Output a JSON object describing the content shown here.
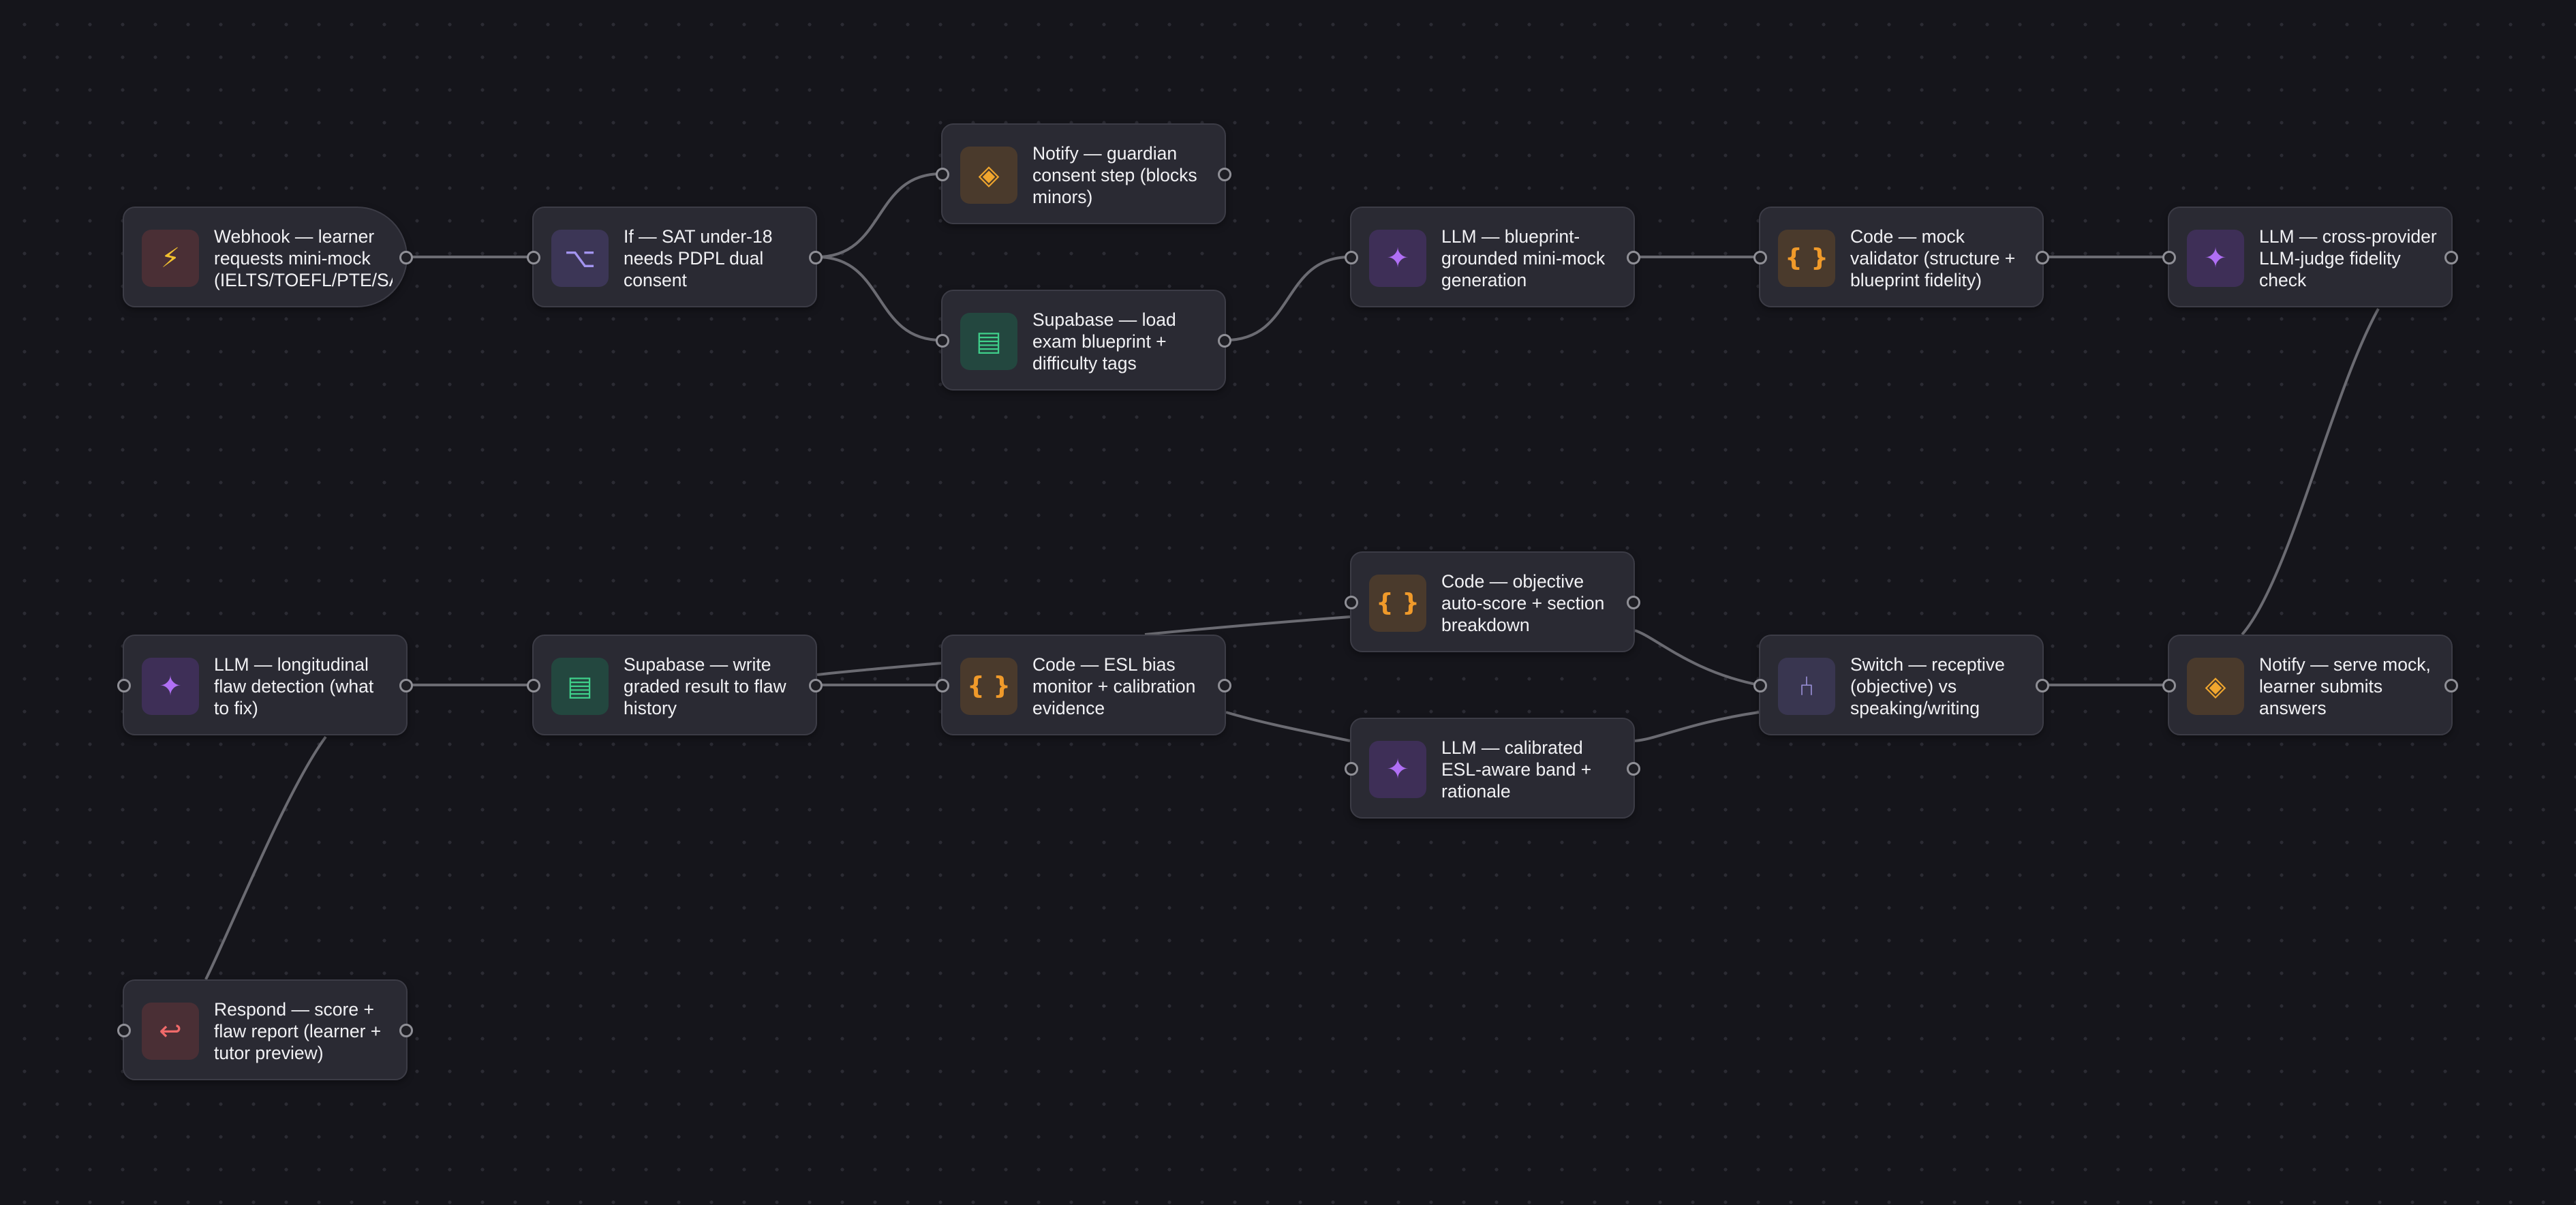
{
  "workflow": {
    "nodes": {
      "webhook": {
        "label": "Webhook — learner requests mini-mock (IELTS/TOEFL/PTE/SAT)",
        "icon": "lightning-icon",
        "symbol": "⚡"
      },
      "if_sat": {
        "label": "If — SAT under-18 needs PDPL dual consent",
        "icon": "branch-icon",
        "symbol": "⌥"
      },
      "notify_guardian": {
        "label": "Notify — guardian consent step (blocks minors)",
        "icon": "diamond-icon",
        "symbol": "◈"
      },
      "supabase_load": {
        "label": "Supabase — load exam blueprint + difficulty tags",
        "icon": "database-table-icon",
        "symbol": "▤"
      },
      "llm_generate": {
        "label": "LLM — blueprint-grounded mini-mock generation",
        "icon": "sparkle-icon",
        "symbol": "✦"
      },
      "code_validator": {
        "label": "Code — mock validator (structure + blueprint fidelity)",
        "icon": "code-braces-icon",
        "symbol": "{ }"
      },
      "llm_judge": {
        "label": "LLM — cross-provider LLM-judge fidelity check",
        "icon": "sparkle-icon",
        "symbol": "✦"
      },
      "notify_serve": {
        "label": "Notify — serve mock, learner submits answers",
        "icon": "diamond-icon",
        "symbol": "◈"
      },
      "switch_receptive": {
        "label": "Switch — receptive (objective) vs speaking/writing",
        "icon": "split-icon",
        "symbol": "⑃"
      },
      "code_autoscore": {
        "label": "Code — objective auto-score + section breakdown",
        "icon": "code-braces-icon",
        "symbol": "{ }"
      },
      "llm_band": {
        "label": "LLM — calibrated ESL-aware band + rationale",
        "icon": "sparkle-icon",
        "symbol": "✦"
      },
      "code_bias": {
        "label": "Code — ESL bias monitor + calibration evidence",
        "icon": "code-braces-icon",
        "symbol": "{ }"
      },
      "supabase_write": {
        "label": "Supabase — write graded result to flaw history",
        "icon": "database-table-icon",
        "symbol": "▤"
      },
      "llm_flaw": {
        "label": "LLM — longitudinal flaw detection (what to fix)",
        "icon": "sparkle-icon",
        "symbol": "✦"
      },
      "respond": {
        "label": "Respond — score + flaw report (learner + tutor preview)",
        "icon": "return-arrow-icon",
        "symbol": "↩"
      }
    },
    "colors": {
      "canvas": "#15151b",
      "node": "#2a2a33",
      "edge": "#6b6b72",
      "llm": "#b06ff5",
      "code": "#f09a2a",
      "database": "#3fcf8a",
      "trigger": "#f2c02f",
      "respond": "#f06a6a"
    }
  }
}
